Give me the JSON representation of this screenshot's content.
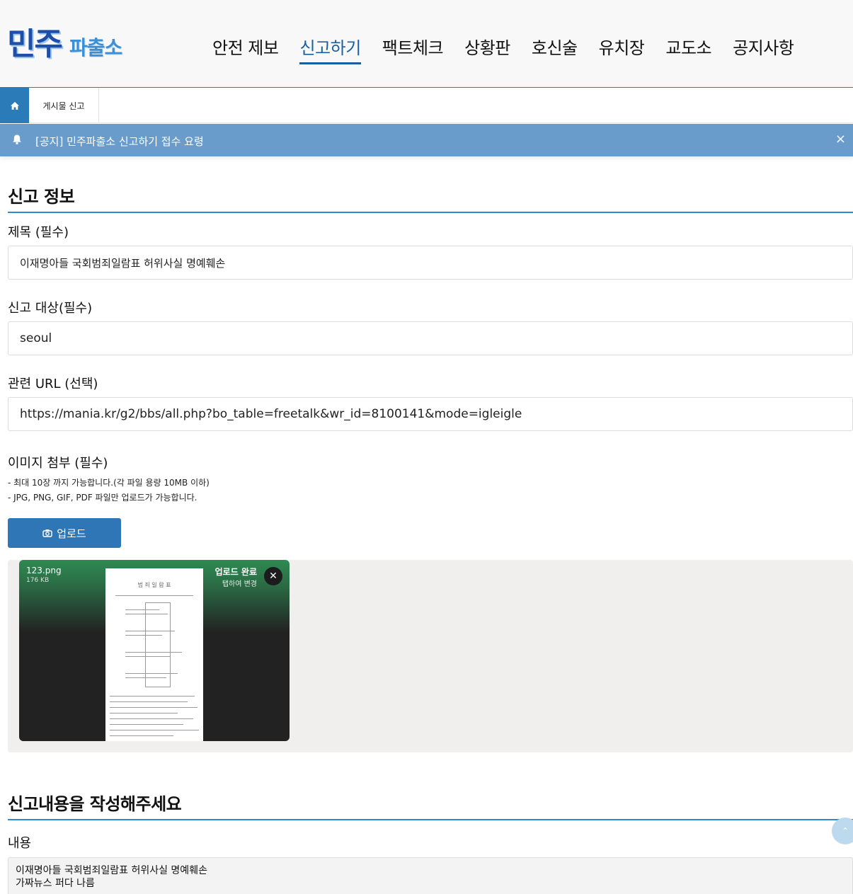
{
  "logo": {
    "big": "민주",
    "small": "파출소"
  },
  "nav": {
    "items": [
      {
        "label": "안전 제보"
      },
      {
        "label": "신고하기"
      },
      {
        "label": "팩트체크"
      },
      {
        "label": "상황판"
      },
      {
        "label": "호신술"
      },
      {
        "label": "유치장"
      },
      {
        "label": "교도소"
      },
      {
        "label": "공지사항"
      }
    ],
    "active": "신고하기"
  },
  "breadcrumb": {
    "home_icon": "home-icon",
    "current": "게시물 신고"
  },
  "notice": {
    "text": "[공지] 민주파출소 신고하기 접수 요령",
    "close": "×"
  },
  "report_info": {
    "title": "신고 정보",
    "subject_label": "제목 (필수)",
    "subject_value": "이재명아들 국회범죄일람표 허위사실 명예훼손",
    "target_label": "신고 대상(필수)",
    "target_value": "seoul",
    "url_label": "관련 URL (선택)",
    "url_value": "https://mania.kr/g2/bbs/all.php?bo_table=freetalk&wr_id=8100141&mode=igleigle"
  },
  "attachment": {
    "label": "이미지 첨부 (필수)",
    "hint1": "- 최대 10장 까지 가능합니다.(각 파일 용량 10MB 이하)",
    "hint2": "- JPG, PNG, GIF, PDF 파일만 업로드가 가능합니다.",
    "upload_button": "업로드",
    "file": {
      "name": "123.png",
      "size": "176 KB",
      "status": "업로드 완료",
      "status_sub": "탭하여 변경",
      "doc_heading": "범 죄 일 람 표"
    }
  },
  "content": {
    "title": "신고내용을 작성해주세요",
    "label": "내용",
    "value": "이재명아들 국회범죄일람표 허위사실 명예훼손\n가짜뉴스 퍼다 나름"
  },
  "colors": {
    "accent": "#2b7bb9",
    "notice_bg": "#6a9ccb",
    "upload_button": "#2f76b6"
  }
}
